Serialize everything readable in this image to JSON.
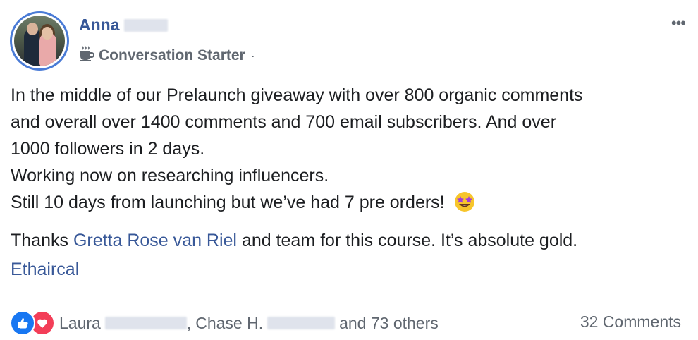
{
  "post": {
    "author_first_name": "Anna",
    "badge_label": "Conversation Starter",
    "separator": "·",
    "more_label": "•••",
    "body_lines": [
      "In the middle of our Prelaunch giveaway with over 800 organic comments",
      "and overall over 1400 comments and 700 email subscribers. And over",
      "1000 followers in 2 days.",
      "Working now on researching influencers.",
      "Still 10 days from launching but we’ve had 7 pre orders!"
    ],
    "thanks_prefix": "Thanks ",
    "mention": "Gretta Rose van Riel",
    "thanks_suffix": " and team for this course. It’s absolute gold.",
    "tag": "Ethaircal"
  },
  "reactions": {
    "first_name": "Laura",
    "comma": ",",
    "second_name": "Chase H.",
    "others": "and 73 others",
    "comments_count": "32 Comments"
  },
  "colors": {
    "link": "#385898",
    "like": "#1877f2",
    "love": "#f33e58",
    "avatar_ring": "#4a7bd6"
  }
}
